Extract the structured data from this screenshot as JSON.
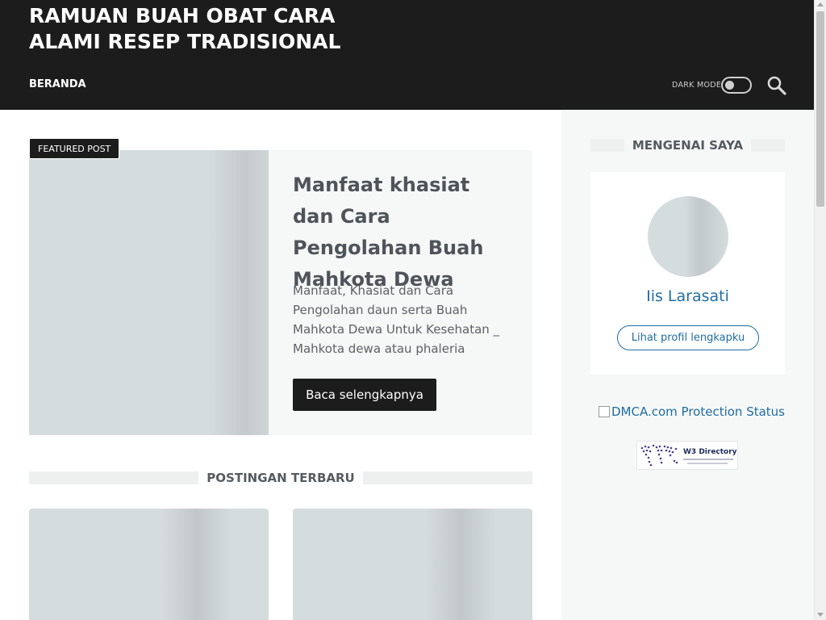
{
  "header": {
    "site_title": "RAMUAN BUAH OBAT CARA ALAMI RESEP TRADISIONAL",
    "nav_home": "BERANDA",
    "dark_mode_label": "DARK MODE",
    "search_icon": "search-icon"
  },
  "featured": {
    "badge": "FEATURED POST",
    "title": "Manfaat khasiat dan Cara Pengolahan Buah Mahkota Dewa",
    "excerpt": "Manfaat, Khasiat dan Cara Pengolahan daun serta Buah Mahkota Dewa Untuk Kesehatan  _ Mahkota dewa atau phaleria macro…",
    "read_more": "Baca selengkapnya"
  },
  "recent": {
    "title": "POSTINGAN TERBARU"
  },
  "sidebar": {
    "about_title": "MENGENAI SAYA",
    "profile_name": "Iis Larasati",
    "profile_button": "Lihat profil lengkapku",
    "dmca_alt": "DMCA.com Protection Status",
    "w3_title": "W3 Directory"
  },
  "colors": {
    "header_bg": "#1c1c1d",
    "accent_link": "#1f6ea3",
    "sidebar_bg": "#f6f7f7"
  }
}
